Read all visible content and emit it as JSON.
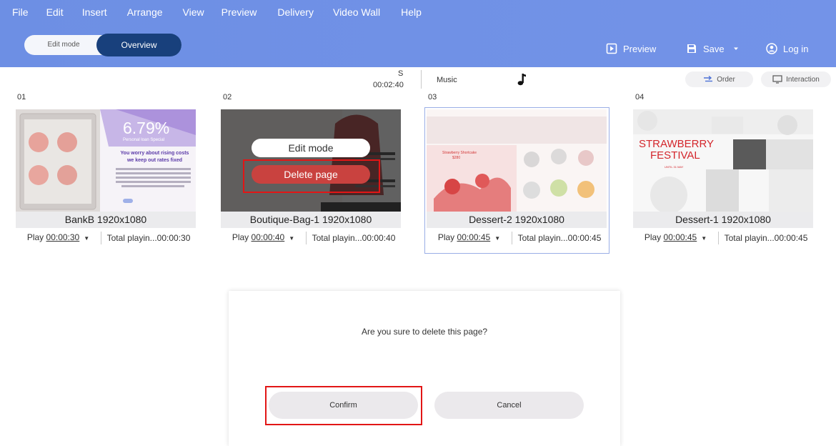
{
  "menu": [
    "File",
    "Edit",
    "Insert",
    "Arrange",
    "View",
    "Preview",
    "Delivery",
    "Video Wall",
    "Help"
  ],
  "mode": {
    "edit_label": "Edit mode",
    "overview_label": "Overview"
  },
  "actions": {
    "preview_label": "Preview",
    "save_label": "Save",
    "login_label": "Log in"
  },
  "timeline": {
    "s_label": "S",
    "duration": "00:02:40",
    "music_label": "Music"
  },
  "toolbar": {
    "order_label": "Order",
    "interaction_label": "Interaction"
  },
  "pages": [
    {
      "num": "01",
      "title": "BankB 1920x1080",
      "play_prefix": "Play ",
      "play_time": "00:00:30",
      "total": "Total playin...00:00:30"
    },
    {
      "num": "02",
      "title": "Boutique-Bag-1 1920x1080",
      "play_prefix": "Play ",
      "play_time": "00:00:40",
      "total": "Total playin...00:00:40"
    },
    {
      "num": "03",
      "title": "Dessert-2 1920x1080",
      "play_prefix": "Play ",
      "play_time": "00:00:45",
      "total": "Total playin...00:00:45"
    },
    {
      "num": "04",
      "title": "Dessert-1 1920x1080",
      "play_prefix": "Play ",
      "play_time": "00:00:45",
      "total": "Total playin...00:00:45"
    }
  ],
  "thumbs": {
    "bank": {
      "rate": "6.79%",
      "special": "Personal loan Special",
      "line1": "You worry about rising costs",
      "line2": "we keep out rates fixed"
    },
    "dessert2": {
      "product": "Strawberry Shortcake",
      "price": "$280"
    },
    "dessert1": {
      "line1": "STRAWBERRY",
      "line2": "FESTIVAL",
      "until": "UNTIL 31 MAY"
    }
  },
  "page_overlay": {
    "edit_label": "Edit mode",
    "delete_label": "Delete page"
  },
  "dialog": {
    "message": "Are you sure to delete this page?",
    "confirm_label": "Confirm",
    "cancel_label": "Cancel"
  },
  "colors": {
    "topbar": "#7393e8",
    "overview_active": "#18407c",
    "delete_red": "#c9423f",
    "highlight": "#e21616",
    "selection": "#9aaee6"
  },
  "icons": {
    "preview": "play-box-icon",
    "save": "floppy-icon",
    "login": "account-circle-icon",
    "music": "music-note-icon",
    "order": "swap-arrows-icon",
    "interaction": "cast-icon"
  }
}
